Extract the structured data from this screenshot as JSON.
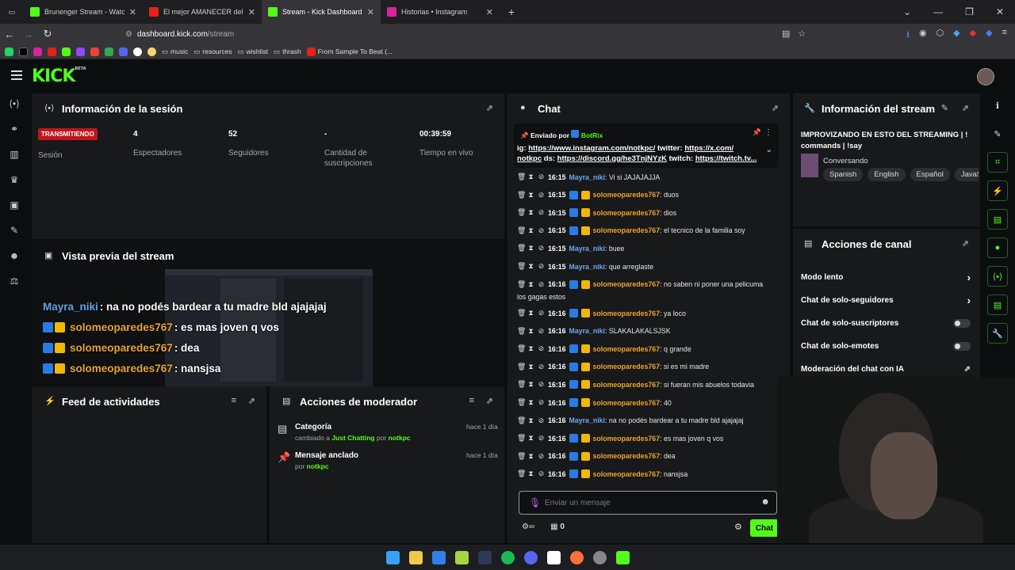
{
  "browser": {
    "tabs": [
      {
        "title": "Brunenger Stream - Watch L",
        "color": "#53fc18",
        "active": false
      },
      {
        "title": "El mejor AMANECER del MUND",
        "color": "#e62117",
        "active": false
      },
      {
        "title": "Stream - Kick Dashboard",
        "color": "#53fc18",
        "active": true
      },
      {
        "title": "Historias • Instagram",
        "color": "#d6249f",
        "active": false
      }
    ],
    "new_tab": "+",
    "url_host": "dashboard.kick.com",
    "url_path": "/stream",
    "bookmarks": [
      "music",
      "resources",
      "wishlist",
      "thrash",
      "From Sample To Beat (..."
    ]
  },
  "header": {
    "logo": "KICK",
    "logo_sup": "BETA"
  },
  "session": {
    "title": "Información de la sesión",
    "live_badge": "TRANSMITIENDO",
    "session_label": "Sesión",
    "stats": [
      {
        "value": "4",
        "label": "Espectadores"
      },
      {
        "value": "52",
        "label": "Seguidores"
      },
      {
        "value": "-",
        "label": "Cantidad de suscripciones"
      },
      {
        "value": "00:39:59",
        "label": "Tiempo en vivo"
      }
    ]
  },
  "preview": {
    "title": "Vista previa del stream",
    "overlay": [
      {
        "user": "Mayra_niki",
        "text": ": na no podés bardear a tu madre bld ajajajaj",
        "badges": false
      },
      {
        "user": "solomeoparedes767",
        "text": ": es mas joven q vos",
        "badges": true
      },
      {
        "user": "solomeoparedes767",
        "text": ": dea",
        "badges": true
      },
      {
        "user": "solomeoparedes767",
        "text": ": nansjsa",
        "badges": true
      }
    ]
  },
  "feed": {
    "title": "Feed de actividades"
  },
  "mod": {
    "title": "Acciones de moderador",
    "items": [
      {
        "title": "Categoría",
        "sub_pre": "cambiado a ",
        "sub_hl": "Just Chatting",
        "sub_mid": " por ",
        "sub_user": "notkpc",
        "when": "hace 1 día"
      },
      {
        "title": "Mensaje anclado",
        "sub_pre": "por ",
        "sub_hl": "",
        "sub_mid": "",
        "sub_user": "notkpc",
        "when": "hace 1 día"
      }
    ]
  },
  "chat": {
    "title": "Chat",
    "pinned_by_pre": "Enviado por",
    "pinned_by_user": "BotRix",
    "pinned_line1_a": "ig: ",
    "pinned_line1_b": "https://www.instagram.com/notkpc/",
    "pinned_line1_c": " twitter: ",
    "pinned_line1_d": "https://x.com/",
    "pinned_line2_a": "notkpc",
    "pinned_line2_b": " ds: ",
    "pinned_line2_c": "https://discord.gg/he3TnjNYzK",
    "pinned_line2_d": " twitch: ",
    "pinned_line2_e": "https://twitch.tv...",
    "messages": [
      {
        "time": "16:15",
        "user": "Mayra_niki",
        "kind": "b",
        "text": ": Vi si JAJAJAJJA"
      },
      {
        "time": "16:15",
        "user": "solomeoparedes767",
        "kind": "o",
        "text": ": duos"
      },
      {
        "time": "16:15",
        "user": "solomeoparedes767",
        "kind": "o",
        "text": ": dios"
      },
      {
        "time": "16:15",
        "user": "solomeoparedes767",
        "kind": "o",
        "text": ": el tecnico de la familia soy"
      },
      {
        "time": "16:15",
        "user": "Mayra_niki",
        "kind": "b",
        "text": ": buee"
      },
      {
        "time": "16:15",
        "user": "Mayra_niki",
        "kind": "b",
        "text": ": que arreglaste"
      },
      {
        "time": "16:16",
        "user": "solomeoparedes767",
        "kind": "o",
        "text": ": no saben ni poner una pelicuma",
        "cont": "los gagas estos"
      },
      {
        "time": "16:16",
        "user": "solomeoparedes767",
        "kind": "o",
        "text": ": ya loco"
      },
      {
        "time": "16:16",
        "user": "Mayra_niki",
        "kind": "b",
        "text": ": SLAKALAKALSJSK"
      },
      {
        "time": "16:16",
        "user": "solomeoparedes767",
        "kind": "o",
        "text": ": q grande"
      },
      {
        "time": "16:16",
        "user": "solomeoparedes767",
        "kind": "o",
        "text": ": si es mi madre"
      },
      {
        "time": "16:16",
        "user": "solomeoparedes767",
        "kind": "o",
        "text": ": si fueran mis abuelos todavia"
      },
      {
        "time": "16:16",
        "user": "solomeoparedes767",
        "kind": "o",
        "text": ": 40"
      },
      {
        "time": "16:16",
        "user": "Mayra_niki",
        "kind": "b",
        "text": ": na no podés bardear a tu madre bld ajajajaj"
      },
      {
        "time": "16:16",
        "user": "solomeoparedes767",
        "kind": "o",
        "text": ": es mas joven q vos"
      },
      {
        "time": "16:16",
        "user": "solomeoparedes767",
        "kind": "o",
        "text": ": dea"
      },
      {
        "time": "16:16",
        "user": "solomeoparedes767",
        "kind": "o",
        "text": ": nansjsa"
      }
    ],
    "input_placeholder": "Enviar un mensaje",
    "points": "0",
    "send_label": "Chat"
  },
  "stream_info": {
    "title": "Información del stream",
    "stream_title": "IMPROVIZANDO EN ESTO DEL STREAMING | ! commands | !say",
    "category": "Conversando",
    "tags": [
      "Spanish",
      "English",
      "Español",
      "JavaSc"
    ]
  },
  "channel_actions": {
    "title": "Acciones de canal",
    "slow": "Modo lento",
    "followers": "Chat de solo-seguidores",
    "subs": "Chat de solo-suscriptores",
    "emotes": "Chat de solo-emotes",
    "ai": "Moderación del chat con IA"
  }
}
